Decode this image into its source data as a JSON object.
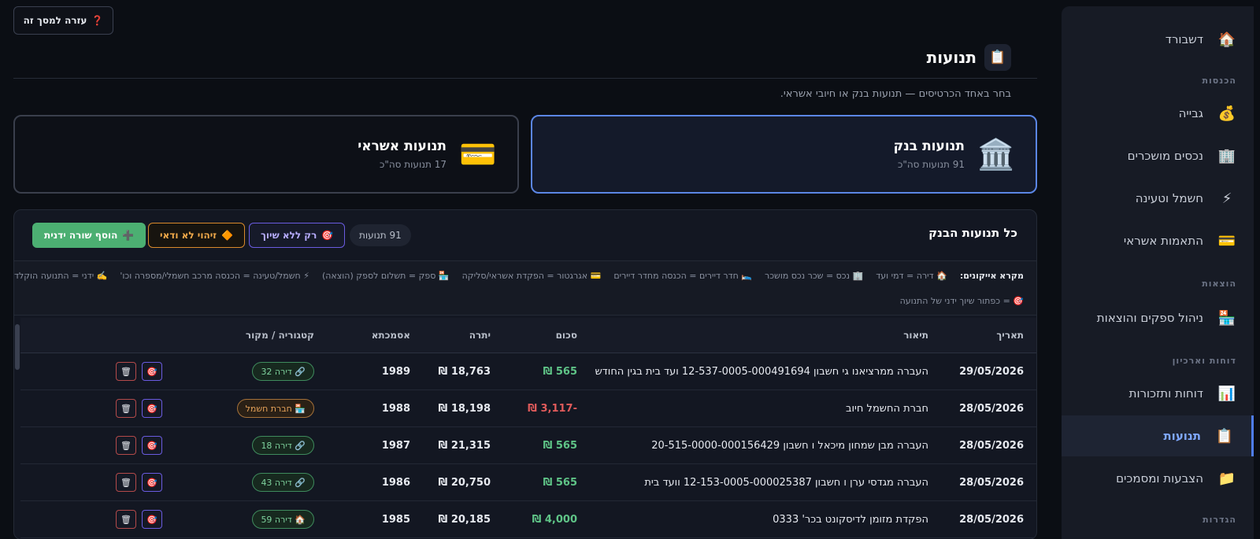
{
  "help_button": {
    "icon": "question-icon",
    "glyph": "❓",
    "label": "עזרה למסך זה"
  },
  "page": {
    "title": "תנועות",
    "title_glyph": "📋",
    "subtitle": "בחר באחד הכרטיסים — תנועות בנק או חיובי אשראי."
  },
  "sidebar": {
    "dashboard": {
      "label": "דשבורד",
      "glyph": "🏠"
    },
    "sections": {
      "income": "הכנסות",
      "expenses": "הוצאות",
      "reports": "דוחות וארכיון",
      "settings": "הגדרות"
    },
    "items": [
      {
        "label": "גבייה",
        "glyph": "💰"
      },
      {
        "label": "נכסים מושכרים",
        "glyph": "🏢"
      },
      {
        "label": "חשמל וטעינה",
        "glyph": "⚡"
      },
      {
        "label": "התאמות אשראי",
        "glyph": "💳"
      },
      {
        "label": "ניהול ספקים והוצאות",
        "glyph": "🏪"
      },
      {
        "label": "דוחות ותזכורות",
        "glyph": "📊"
      },
      {
        "label": "תנועות",
        "glyph": "📋",
        "active": true
      },
      {
        "label": "הצבעות ומסמכים",
        "glyph": "📁"
      }
    ]
  },
  "cards": {
    "bank": {
      "title": "תנועות בנק",
      "subtitle": "91 תנועות סה\"כ",
      "glyph": "🏛️",
      "selected": true
    },
    "credit": {
      "title": "תנועות אשראי",
      "subtitle": "17 תנועות סה\"כ",
      "glyph": "💳",
      "selected": false
    }
  },
  "panel": {
    "title": "כל תנועות הבנק",
    "count": "91 תנועות",
    "unassigned_button": {
      "glyph": "🎯",
      "label": "רק ללא שיוך"
    },
    "uncertain_button": {
      "glyph": "🔶",
      "label": "זיהוי לא ודאי"
    },
    "add_button": {
      "glyph": "➕",
      "label": "הוסף שורה ידנית"
    }
  },
  "legend": {
    "label": "מקרא אייקונים:",
    "items": [
      "🏠 דירה = דמי ועד",
      "🏢 נכס = שכר נכס מושכר",
      "🛌 חדר דיירים = הכנסה מחדר דיירים",
      "💳 אגרגטור = הפקדת אשראי/סליקה",
      "🏪 ספק = תשלום לספק (הוצאה)",
      "⚡ חשמל/טעינה = הכנסה מרכב חשמלי/מספרה וכו'",
      "✍️ ידני = התנועה הוקלדה ידנית"
    ],
    "row2": "🎯 = כפתור שיוך ידני של התנועה"
  },
  "table": {
    "headers": {
      "date": "תאריך",
      "description": "תיאור",
      "amount": "סכום",
      "balance": "יתרה",
      "reference": "אסמכתא",
      "category": "קטגוריה / מקור"
    },
    "rows": [
      {
        "date": "29/05/2026",
        "description": "העברה ממרציאנו גי חשבון 12-537-0005-000491694 ועד בית בגין החודש",
        "amount": "565 ₪",
        "sign": "pos",
        "balance": "18,763 ₪",
        "reference": "1989",
        "category": "🔗 דירה 32",
        "cat_type": "apt"
      },
      {
        "date": "28/05/2026",
        "description": "חברת החשמל חיוב",
        "amount": "-3,117 ₪",
        "sign": "neg",
        "balance": "18,198 ₪",
        "reference": "1988",
        "category": "🏪 חברת חשמל",
        "cat_type": "supplier"
      },
      {
        "date": "28/05/2026",
        "description": "העברה מבן שמחון מיכאל ו חשבון 20-515-0000-000156429",
        "amount": "565 ₪",
        "sign": "pos",
        "balance": "21,315 ₪",
        "reference": "1987",
        "category": "🔗 דירה 18",
        "cat_type": "apt"
      },
      {
        "date": "28/05/2026",
        "description": "העברה מגדסי ערן ו חשבון 12-153-0005-000025387 וועד בית",
        "amount": "565 ₪",
        "sign": "pos",
        "balance": "20,750 ₪",
        "reference": "1986",
        "category": "🔗 דירה 43",
        "cat_type": "apt"
      },
      {
        "date": "28/05/2026",
        "description": "הפקדת מזומן לדיסקונט בכר' 0333",
        "amount": "4,000 ₪",
        "sign": "pos",
        "balance": "20,185 ₪",
        "reference": "1985",
        "category": "🏠 דירה 59",
        "cat_type": "apt"
      }
    ],
    "actions": {
      "assign_glyph": "🎯",
      "delete_glyph": "🗑"
    }
  }
}
